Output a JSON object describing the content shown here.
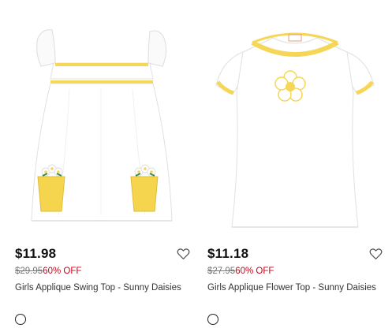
{
  "products": [
    {
      "price": "$11.98",
      "original_price": "$29.95",
      "discount": "60% OFF",
      "name": "Girls Applique Swing Top - Sunny Daisies",
      "wishlist_icon": "heart-outline-icon",
      "swatch_color": "#ffffff"
    },
    {
      "price": "$11.18",
      "original_price": "$27.95",
      "discount": "60% OFF",
      "name": "Girls Applique Flower Top - Sunny Daisies",
      "wishlist_icon": "heart-outline-icon",
      "swatch_color": "#ffffff"
    }
  ],
  "colors": {
    "price": "#111111",
    "original_price": "#777777",
    "discount": "#d0021b",
    "trim_yellow": "#f6d656"
  }
}
